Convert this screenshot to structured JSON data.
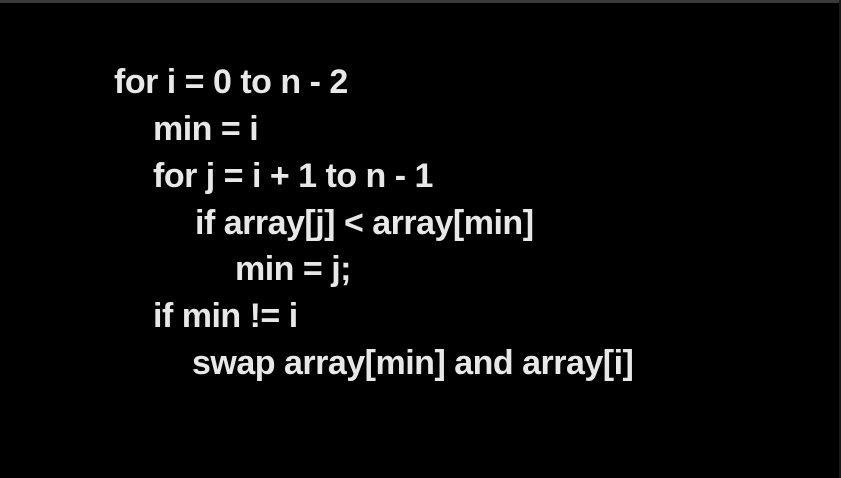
{
  "colors": {
    "background": "#000000",
    "text": "#e8e8e8"
  },
  "pseudocode": {
    "lines": [
      "for i = 0 to n - 2",
      "min = i",
      "for j = i + 1 to n - 1",
      "if array[j] < array[min]",
      "min = j;",
      "if min != i",
      "swap array[min] and array[i]"
    ]
  }
}
